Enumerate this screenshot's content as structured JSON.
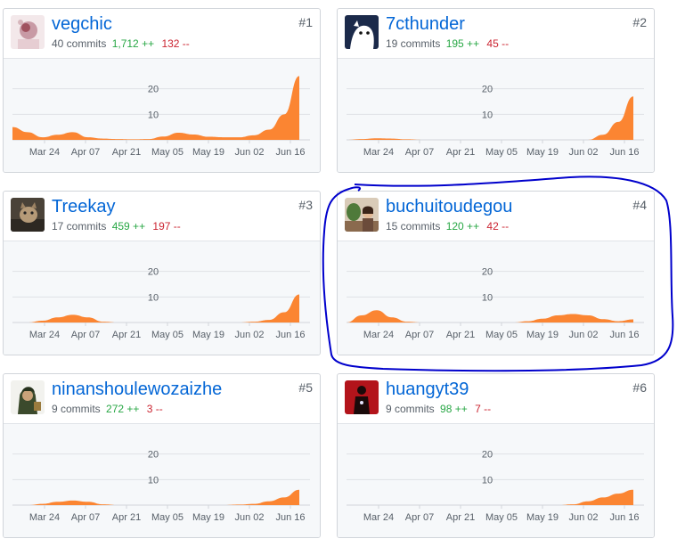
{
  "contributors": [
    {
      "rank": "#1",
      "name": "vegchic",
      "commits": "40 commits",
      "additions": "1,712 ++",
      "deletions": "132 --",
      "avatar": "vegchic-avatar",
      "weekly": [
        5,
        3,
        1,
        2,
        3,
        1,
        0.5,
        0.3,
        0.2,
        0.3,
        1.3,
        2.8,
        2.1,
        1.2,
        1.0,
        1.0,
        1.8,
        4,
        10,
        25
      ]
    },
    {
      "rank": "#2",
      "name": "7cthunder",
      "commits": "19 commits",
      "additions": "195 ++",
      "deletions": "45 --",
      "avatar": "7cthunder-avatar",
      "weekly": [
        0,
        0.3,
        0.6,
        0.5,
        0.2,
        0,
        0,
        0,
        0,
        0,
        0,
        0,
        0,
        0,
        0,
        0,
        0,
        2,
        7,
        17
      ]
    },
    {
      "rank": "#3",
      "name": "Treekay",
      "commits": "17 commits",
      "additions": "459 ++",
      "deletions": "197 --",
      "avatar": "treekay-avatar",
      "weekly": [
        0,
        0,
        0.7,
        2,
        3,
        2,
        0.3,
        0,
        0,
        0,
        0,
        0,
        0,
        0,
        0,
        0,
        0.3,
        1,
        4,
        11
      ]
    },
    {
      "rank": "#4",
      "name": "buchuitoudegou",
      "commits": "15 commits",
      "additions": "120 ++",
      "deletions": "42 --",
      "avatar": "buchuitoudegou-avatar",
      "weekly": [
        0,
        2.8,
        4.8,
        2,
        0.3,
        0,
        0,
        0,
        0,
        0,
        0,
        0,
        0.5,
        1.5,
        2.8,
        3.3,
        2.8,
        1.3,
        0.5,
        1.2
      ]
    },
    {
      "rank": "#5",
      "name": "ninanshoulewozaizhe",
      "commits": "9 commits",
      "additions": "272 ++",
      "deletions": "3 --",
      "avatar": "ninanshoulewozaizhe-avatar",
      "weekly": [
        0,
        0,
        0.5,
        1.3,
        1.8,
        1.3,
        0.3,
        0,
        0,
        0,
        0,
        0,
        0,
        0,
        0,
        0.2,
        0.5,
        1.5,
        3,
        6
      ]
    },
    {
      "rank": "#6",
      "name": "huangyt39",
      "commits": "9 commits",
      "additions": "98 ++",
      "deletions": "7 --",
      "avatar": "huangyt39-avatar",
      "weekly": [
        0,
        0,
        0,
        0,
        0,
        0,
        0,
        0,
        0,
        0,
        0,
        0,
        0,
        0,
        0,
        0.3,
        1.5,
        3,
        4.5,
        6
      ]
    }
  ],
  "chart_axes": {
    "y_ticks": [
      "10",
      "20"
    ],
    "x_ticks": [
      "Mar 24",
      "Apr 07",
      "Apr 21",
      "May 05",
      "May 19",
      "Jun 02",
      "Jun 16"
    ],
    "ymax": 30
  },
  "colors": {
    "area": "#fb8532",
    "link": "#0366d6",
    "additions": "#28a745",
    "deletions": "#cb2431",
    "highlight": "#0000cc"
  }
}
